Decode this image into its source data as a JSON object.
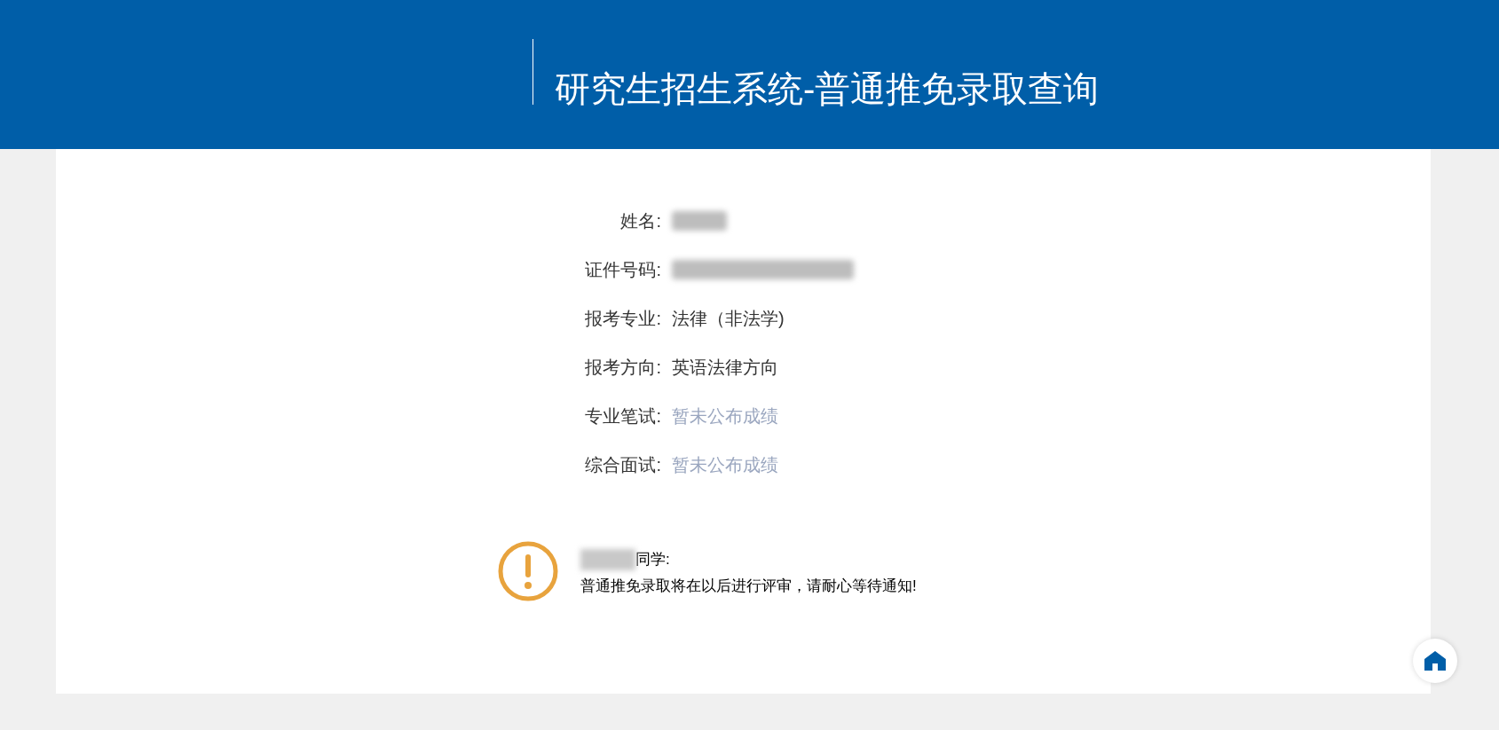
{
  "header": {
    "title": "研究生招生系统-普通推免录取查询"
  },
  "fields": [
    {
      "label": "姓名:",
      "kind": "redacted"
    },
    {
      "label": "证件号码:",
      "kind": "redacted"
    },
    {
      "label": "报考专业:",
      "value": "法律（非法学)",
      "kind": "text"
    },
    {
      "label": "报考方向:",
      "value": "英语法律方向",
      "kind": "text"
    },
    {
      "label": "专业笔试:",
      "value": "暂未公布成绩",
      "kind": "pending"
    },
    {
      "label": "综合面试:",
      "value": "暂未公布成绩",
      "kind": "pending"
    }
  ],
  "notice": {
    "name_redacted": true,
    "greeting": "同学:",
    "message": "普通推免录取将在以后进行评审，请耐心等待通知!"
  }
}
